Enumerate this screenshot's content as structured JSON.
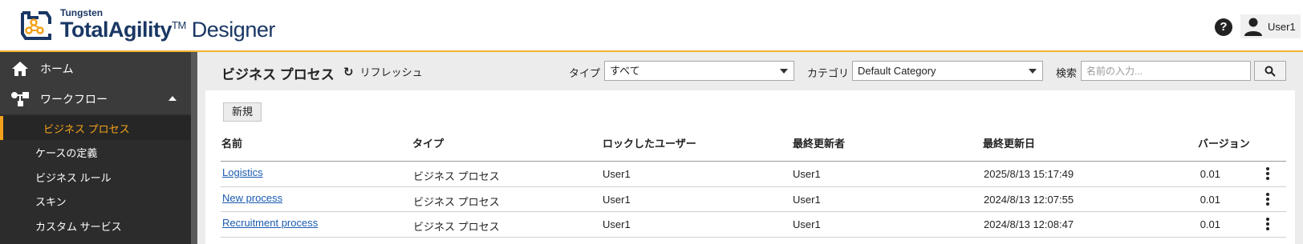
{
  "app": {
    "brand_small": "Tungsten",
    "brand_main": "TotalAgility",
    "brand_tm": "TM",
    "brand_designer": "Designer",
    "accent_color": "#f4a21b",
    "brand_color": "#1a3764"
  },
  "header": {
    "help_icon": "?",
    "user_name": "User1"
  },
  "sidebar": {
    "home_label": "ホーム",
    "workflow_label": "ワークフロー",
    "sub_items": [
      {
        "label": "ビジネス プロセス",
        "active": true
      },
      {
        "label": "ケースの定義",
        "active": false
      },
      {
        "label": "ビジネス ルール",
        "active": false
      },
      {
        "label": "スキン",
        "active": false
      },
      {
        "label": "カスタム サービス",
        "active": false
      }
    ]
  },
  "toolbar": {
    "page_title": "ビジネス プロセス",
    "refresh_label": "リフレッシュ",
    "type_label": "タイプ",
    "type_value": "すべて",
    "category_label": "カテゴリ",
    "category_value": "Default Category",
    "search_label": "検索",
    "search_placeholder": "名前の入力...",
    "new_label": "新規"
  },
  "table": {
    "headers": [
      "名前",
      "タイプ",
      "ロックしたユーザー",
      "最終更新者",
      "最終更新日",
      "バージョン"
    ],
    "rows": [
      {
        "name": "Logistics",
        "type": "ビジネス プロセス",
        "locked_by": "User1",
        "updated_by": "User1",
        "updated_at": "2025/8/13 15:17:49",
        "version": "0.01"
      },
      {
        "name": "New process",
        "type": "ビジネス プロセス",
        "locked_by": "User1",
        "updated_by": "User1",
        "updated_at": "2024/8/13 12:07:55",
        "version": "0.01"
      },
      {
        "name": "Recruitment process",
        "type": "ビジネス プロセス",
        "locked_by": "User1",
        "updated_by": "User1",
        "updated_at": "2024/8/13 12:08:47",
        "version": "0.01"
      }
    ]
  }
}
